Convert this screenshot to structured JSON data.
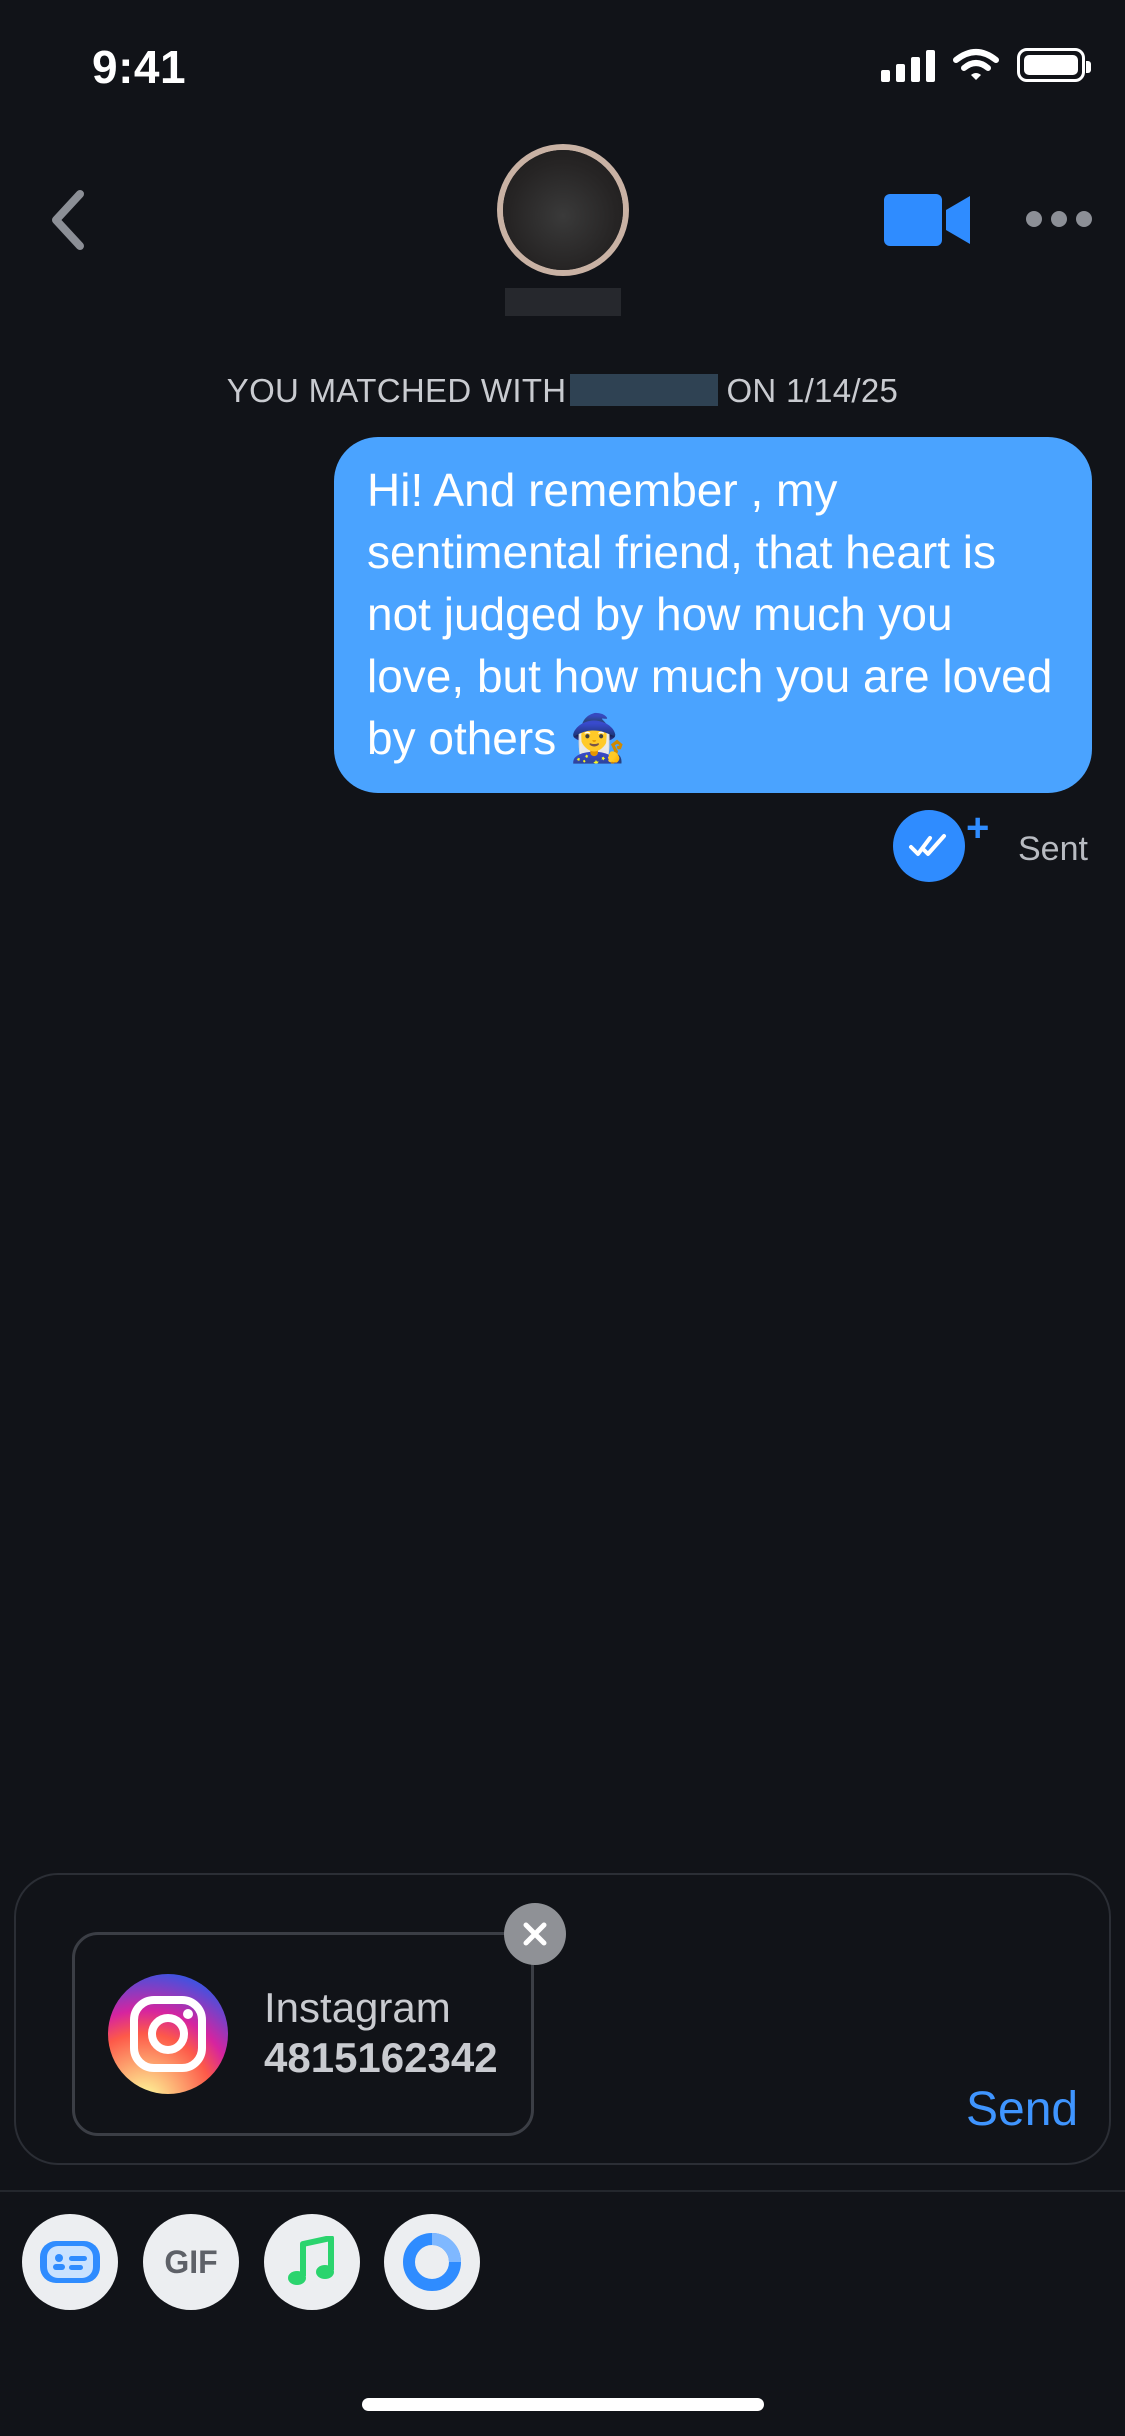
{
  "status_bar": {
    "time": "9:41",
    "icons": [
      "signal-icon",
      "wifi-icon",
      "battery-icon"
    ]
  },
  "header": {
    "back_icon": "chevron-left-icon",
    "avatar": "avatar",
    "video_icon": "video-camera-icon",
    "more_icon": "more-horizontal-icon"
  },
  "chat": {
    "match_prefix": "YOU MATCHED WITH",
    "match_suffix": "ON 1/14/25",
    "messages": [
      {
        "text": "Hi! And remember , my sentimental friend, that heart is not judged by how much you love, but how much you are loved by others 🧙‍♀️",
        "status": "Sent"
      }
    ]
  },
  "composer": {
    "attachment": {
      "type": "Instagram",
      "value": "4815162342",
      "icon": "instagram-icon",
      "remove_icon": "close-icon"
    },
    "send_label": "Send"
  },
  "toolbar": {
    "gif_label": "GIF",
    "tools": [
      "card-icon",
      "gif-icon",
      "music-note-icon",
      "circle-ring-icon"
    ]
  },
  "colors": {
    "background": "#111318",
    "bubble": "#4aa3ff",
    "accent": "#2f8cff",
    "send": "#3f95ff"
  }
}
